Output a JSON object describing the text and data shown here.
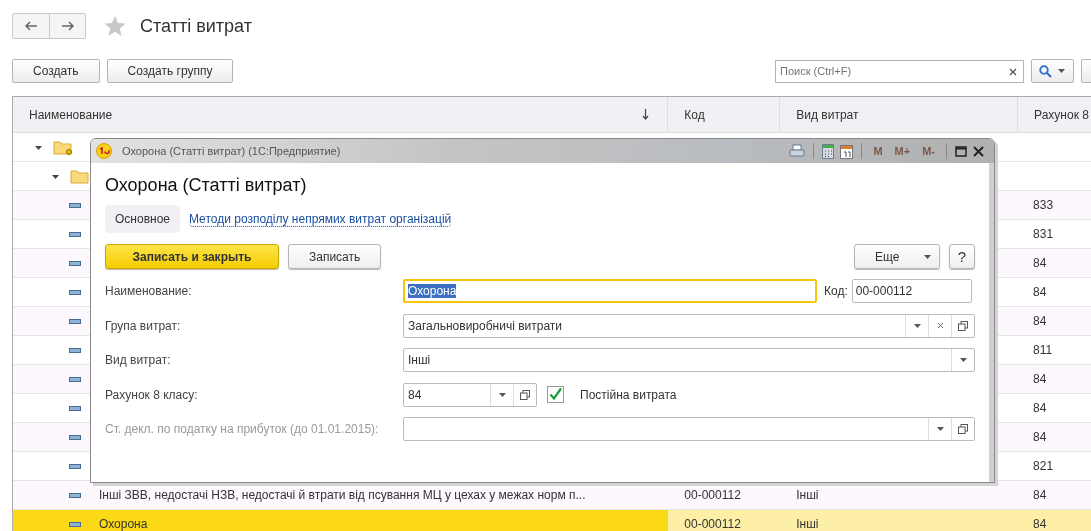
{
  "page": {
    "title": "Статті витрат",
    "buttons": [
      "Создать",
      "Создать группу"
    ],
    "search": {
      "placeholder": "Поиск (Ctrl+F)"
    }
  },
  "table": {
    "columns": [
      {
        "label": "Наименование",
        "sorted": true
      },
      {
        "label": "Код",
        "sorted": false
      },
      {
        "label": "Вид витрат",
        "sorted": false
      },
      {
        "label": "Рахунок 8",
        "sorted": false
      }
    ],
    "rows": [
      {
        "kind": "folder",
        "expanded": true,
        "children": [
          {
            "kind": "folder",
            "expanded": true,
            "children": [
              {
                "kind": "item",
                "account": "833",
                "selected": false
              },
              {
                "kind": "item",
                "account": "831",
                "selected": false
              },
              {
                "kind": "item",
                "account": "84",
                "selected": false
              },
              {
                "kind": "item",
                "account": "84",
                "selected": false
              },
              {
                "kind": "item",
                "account": "84",
                "selected": false
              },
              {
                "kind": "item",
                "account": "811",
                "selected": false
              },
              {
                "kind": "item",
                "account": "84",
                "selected": false
              },
              {
                "kind": "item",
                "account": "84",
                "selected": false
              },
              {
                "kind": "item",
                "account": "84",
                "selected": false
              },
              {
                "kind": "item",
                "account": "821",
                "selected": false
              },
              {
                "kind": "item",
                "name": "Інші ЗВВ, недостачі НЗВ, недостачі й втрати від псування МЦ у цехах у межах норм п...",
                "code": "00-000112",
                "type": "Інші",
                "account": "84",
                "selected": false
              },
              {
                "kind": "item",
                "name": "Охорона",
                "code": "00-000112",
                "type": "Інші",
                "account": "84",
                "selected": true
              }
            ]
          }
        ]
      }
    ]
  },
  "dialog": {
    "title": "Охорона (Статті витрат)  (1С:Предприятие)",
    "memory_buttons": [
      {
        "label": "M",
        "disabled": true
      },
      {
        "label": "M+",
        "disabled": true
      },
      {
        "label": "M-",
        "disabled": true
      }
    ],
    "heading": "Охорона (Статті витрат)",
    "tabs": [
      {
        "label": "Основное",
        "selected": true
      },
      {
        "label": "Методи розподілу непрямих витрат організацій",
        "selected": false
      }
    ],
    "buttons": [
      {
        "label": "Записать и закрыть",
        "kind": "primary"
      },
      {
        "label": "Записать",
        "kind": "plain"
      }
    ],
    "more_button": "Еще",
    "help_button": "?",
    "fields": [
      {
        "kind": "name",
        "label": "Наименование:",
        "value": "Охорона",
        "disabled": false,
        "code_label": "Код:",
        "code_value": "00-000112"
      },
      {
        "kind": "combo",
        "label": "Група витрат:",
        "value": "Загальновиробничі витрати",
        "disabled": false,
        "clear": true,
        "open": true
      },
      {
        "kind": "combo",
        "label": "Вид витрат:",
        "value": "Інші",
        "disabled": false,
        "clear": false,
        "open": false
      },
      {
        "kind": "account",
        "label": "Рахунок 8 класу:",
        "value": "84",
        "disabled": false,
        "open": true,
        "check_label": "Постійна витрата",
        "checked": true
      },
      {
        "kind": "combo",
        "label": "Ст. декл. по податку на прибуток (до 01.01.2015):",
        "disabled": true,
        "clear": false,
        "open": true
      }
    ]
  }
}
